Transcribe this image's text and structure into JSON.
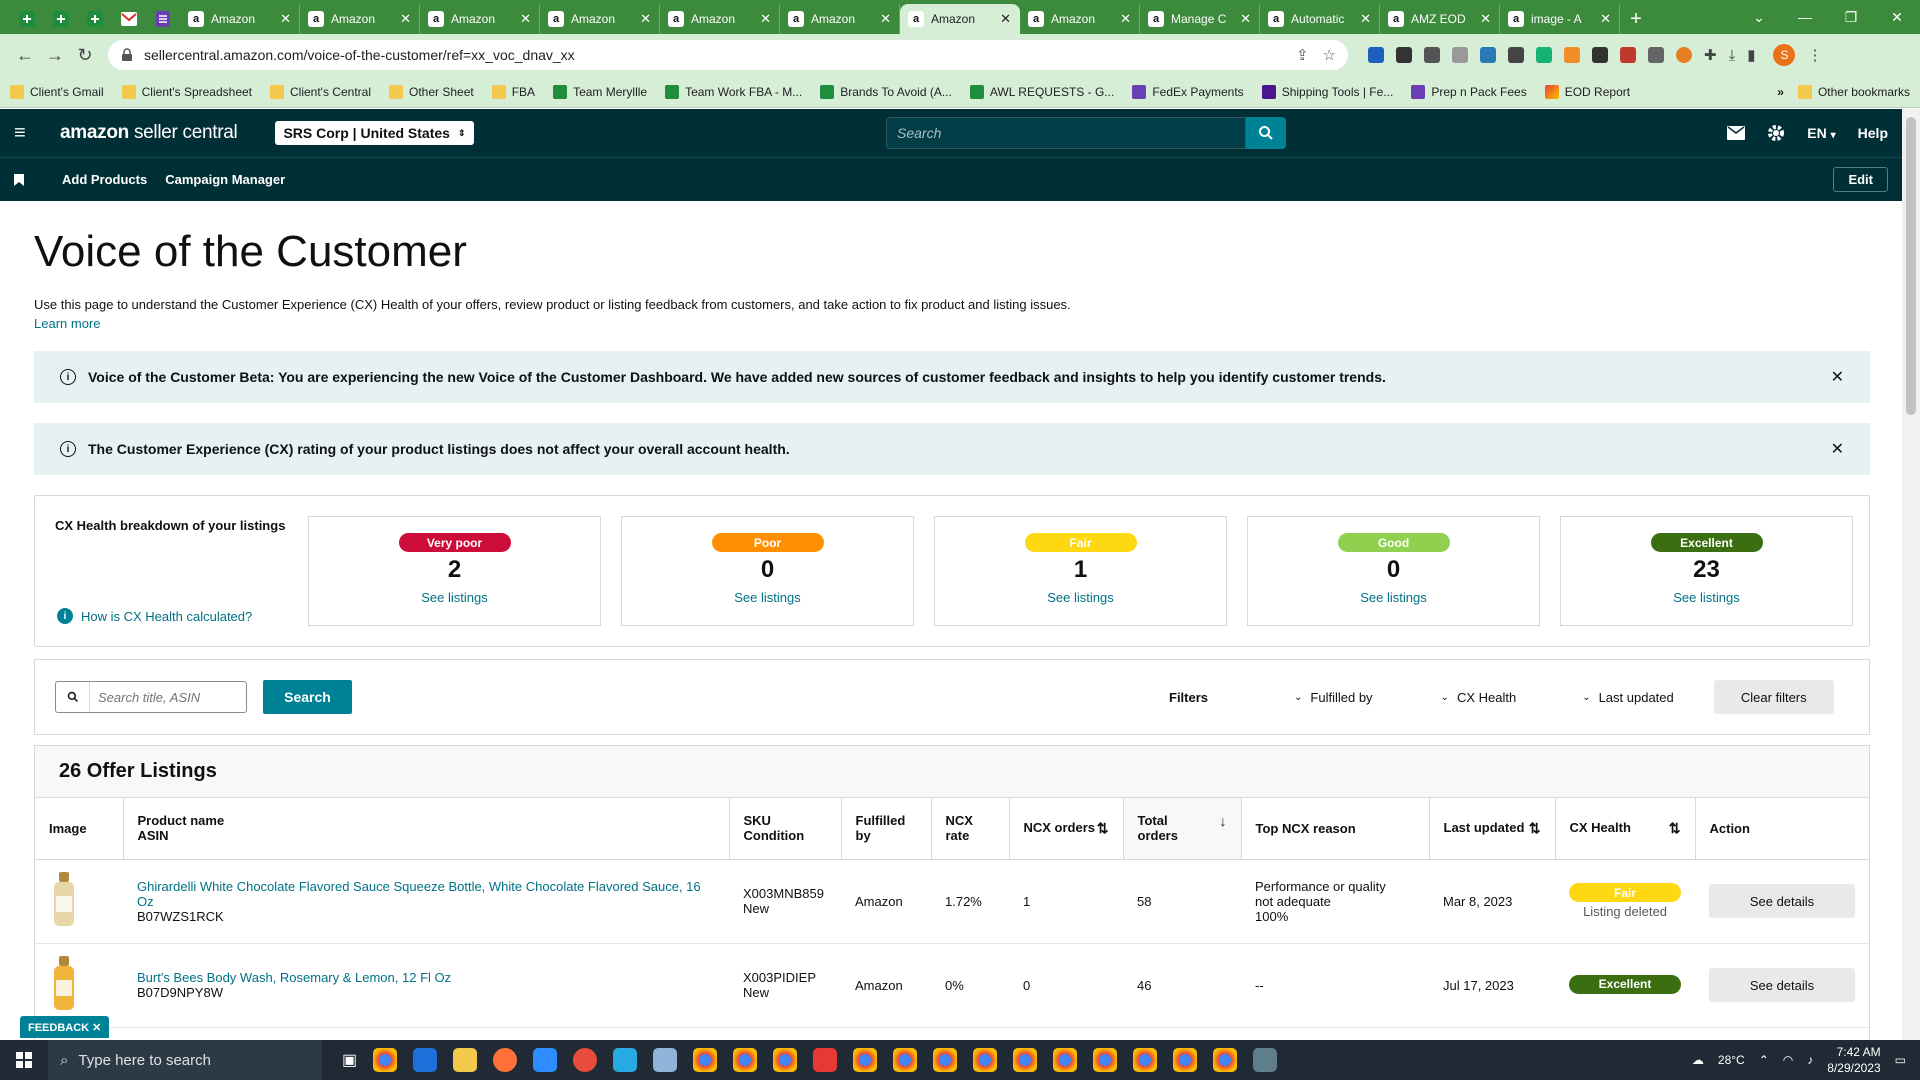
{
  "browser": {
    "tabs": [
      {
        "title": "Amazon"
      },
      {
        "title": "Amazon"
      },
      {
        "title": "Amazon"
      },
      {
        "title": "Amazon"
      },
      {
        "title": "Amazon"
      },
      {
        "title": "Amazon"
      },
      {
        "title": "Amazon",
        "active": true
      },
      {
        "title": "Amazon"
      },
      {
        "title": "Manage C"
      },
      {
        "title": "Automatic"
      },
      {
        "title": "AMZ EOD"
      },
      {
        "title": "image - A"
      }
    ],
    "url": "sellercentral.amazon.com/voice-of-the-customer/ref=xx_voc_dnav_xx",
    "profile_initial": "S",
    "bookmarks": [
      {
        "label": "Client's Gmail",
        "kind": "folder"
      },
      {
        "label": "Client's Spreadsheet",
        "kind": "folder"
      },
      {
        "label": "Client's Central",
        "kind": "folder"
      },
      {
        "label": "Other Sheet",
        "kind": "folder"
      },
      {
        "label": "FBA",
        "kind": "folder"
      },
      {
        "label": "Team Meryllle",
        "kind": "green"
      },
      {
        "label": "Team Work FBA - M...",
        "kind": "green"
      },
      {
        "label": "Brands To Avoid (A...",
        "kind": "green"
      },
      {
        "label": "AWL REQUESTS - G...",
        "kind": "green"
      },
      {
        "label": "FedEx Payments",
        "kind": "purple"
      },
      {
        "label": "Shipping Tools | Fe...",
        "kind": "fedex"
      },
      {
        "label": "Prep n Pack Fees",
        "kind": "purple"
      },
      {
        "label": "EOD Report",
        "kind": "multi"
      }
    ],
    "other_bookmarks": "Other bookmarks",
    "more_bookmarks": "»"
  },
  "header": {
    "logo_main": "amazon",
    "logo_sub": "seller central",
    "store": "SRS Corp | United States",
    "search_placeholder": "Search",
    "language": "EN",
    "help": "Help",
    "nav": [
      "Add Products",
      "Campaign Manager"
    ],
    "edit": "Edit"
  },
  "page": {
    "title": "Voice of the Customer",
    "intro": "Use this page to understand the Customer Experience (CX) Health of your offers, review product or listing feedback from customers, and take action to fix product and listing issues.",
    "learn_more": "Learn more",
    "alerts": [
      "Voice of the Customer Beta: You are experiencing the new Voice of the Customer Dashboard. We have added new sources of customer feedback and insights to help you identify customer trends.",
      "The Customer Experience (CX) rating of your product listings does not affect your overall account health."
    ]
  },
  "cx": {
    "title": "CX Health breakdown of your listings",
    "how": "How is CX Health calculated?",
    "see_listings": "See listings",
    "cards": [
      {
        "label": "Very poor",
        "count": "2",
        "bg": "#cc0c39",
        "fg": "#ffffff"
      },
      {
        "label": "Poor",
        "count": "0",
        "bg": "#ff8f00",
        "fg": "#ffffff"
      },
      {
        "label": "Fair",
        "count": "1",
        "bg": "#ffd814",
        "fg": "#ffffff"
      },
      {
        "label": "Good",
        "count": "0",
        "bg": "#8fd14f",
        "fg": "#ffffff"
      },
      {
        "label": "Excellent",
        "count": "23",
        "bg": "#3b6e11",
        "fg": "#ffffff"
      }
    ]
  },
  "filters": {
    "search_placeholder": "Search title, ASIN",
    "search_button": "Search",
    "label": "Filters",
    "dropdowns": [
      "Fulfilled by",
      "CX Health",
      "Last updated"
    ],
    "clear": "Clear filters"
  },
  "listings": {
    "count_title": "26 Offer Listings",
    "columns": {
      "image": "Image",
      "product": "Product name",
      "asin": "ASIN",
      "sku": "SKU",
      "condition": "Condition",
      "fulfilled": "Fulfilled by",
      "ncx_rate": "NCX rate",
      "ncx_orders": "NCX orders",
      "total_orders_1": "Total",
      "total_orders_2": "orders",
      "top_reason": "Top NCX reason",
      "last_updated": "Last updated",
      "cx_health": "CX Health",
      "action": "Action"
    },
    "rows": [
      {
        "product": "Ghirardelli White Chocolate Flavored Sauce Squeeze Bottle, White Chocolate Flavored Sauce, 16 Oz",
        "asin": "B07WZS1RCK",
        "sku": "X003MNB859",
        "condition": "New",
        "fulfilled": "Amazon",
        "ncx_rate": "1.72%",
        "ncx_orders": "1",
        "total_orders": "58",
        "reason_1": "Performance or quality",
        "reason_2": "not adequate",
        "reason_3": "100%",
        "updated": "Mar 8, 2023",
        "health": "Fair",
        "health_bg": "#ffd814",
        "health_note": "Listing deleted",
        "action": "See details"
      },
      {
        "product": "Burt's Bees Body Wash, Rosemary & Lemon, 12 Fl Oz",
        "asin": "B07D9NPY8W",
        "sku": "X003PIDIEP",
        "condition": "New",
        "fulfilled": "Amazon",
        "ncx_rate": "0%",
        "ncx_orders": "0",
        "total_orders": "46",
        "reason_1": "--",
        "reason_2": "",
        "reason_3": "",
        "updated": "Jul 17, 2023",
        "health": "Excellent",
        "health_bg": "#3b6e11",
        "health_note": "",
        "action": "See details"
      }
    ]
  },
  "feedback": "FEEDBACK ✕",
  "taskbar": {
    "search": "Type here to search",
    "weather": "28°C",
    "time": "7:42 AM",
    "date": "8/29/2023"
  }
}
